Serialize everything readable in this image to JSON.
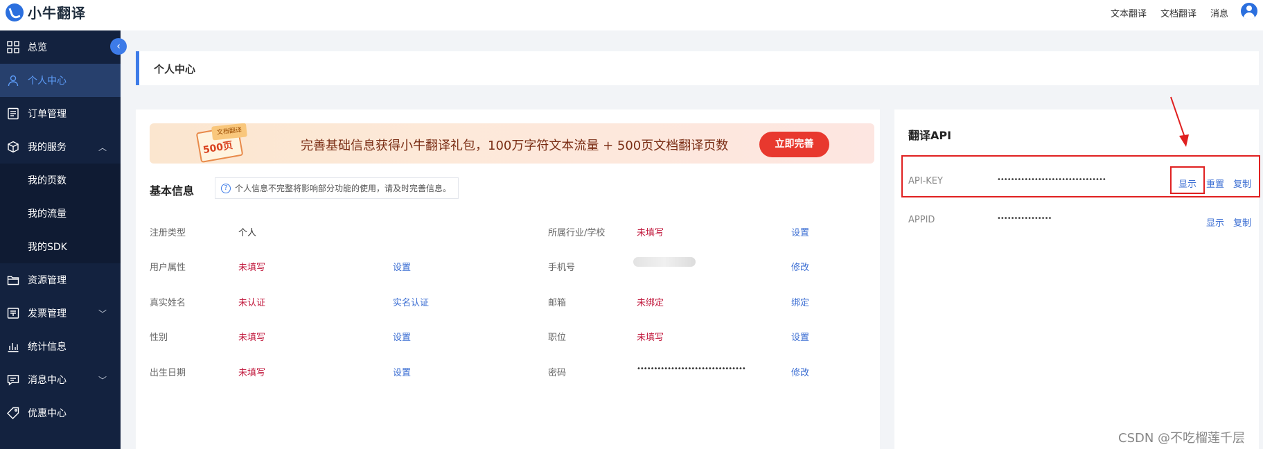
{
  "header": {
    "logo_text": "小牛翻译",
    "nav": [
      "文本翻译",
      "文档翻译",
      "消息"
    ]
  },
  "sidebar": {
    "items": [
      {
        "label": "总览",
        "icon": "grid-icon"
      },
      {
        "label": "个人中心",
        "icon": "user-icon",
        "active": true
      },
      {
        "label": "订单管理",
        "icon": "order-icon"
      },
      {
        "label": "我的服务",
        "icon": "service-icon",
        "expanded": true
      },
      {
        "label": "我的页数",
        "sub": true
      },
      {
        "label": "我的流量",
        "sub": true
      },
      {
        "label": "我的SDK",
        "sub": true
      },
      {
        "label": "资源管理",
        "icon": "folder-icon"
      },
      {
        "label": "发票管理",
        "icon": "invoice-icon"
      },
      {
        "label": "统计信息",
        "icon": "chart-icon"
      },
      {
        "label": "消息中心",
        "icon": "message-icon"
      },
      {
        "label": "优惠中心",
        "icon": "tag-icon"
      }
    ]
  },
  "page": {
    "title": "个人中心"
  },
  "banner": {
    "ticket_label": "500页",
    "ticket_top": "文档翻译",
    "text": "完善基础信息获得小牛翻译礼包，100万字符文本流量 + 500页文档翻译页数",
    "button": "立即完善"
  },
  "basic_info": {
    "title": "基本信息",
    "hint": "个人信息不完整将影响部分功能的使用，请及时完善信息。",
    "left_fields": [
      {
        "label": "注册类型",
        "value": "个人",
        "warn": false,
        "action": ""
      },
      {
        "label": "用户属性",
        "value": "未填写",
        "warn": true,
        "action": "设置"
      },
      {
        "label": "真实姓名",
        "value": "未认证",
        "warn": true,
        "action": "实名认证"
      },
      {
        "label": "性别",
        "value": "未填写",
        "warn": true,
        "action": "设置"
      },
      {
        "label": "出生日期",
        "value": "未填写",
        "warn": true,
        "action": "设置"
      }
    ],
    "right_fields": [
      {
        "label": "所属行业/学校",
        "value": "未填写",
        "warn": true,
        "action": "设置"
      },
      {
        "label": "手机号",
        "value": "",
        "warn": false,
        "action": "修改",
        "blurred": true
      },
      {
        "label": "邮箱",
        "value": "未绑定",
        "warn": true,
        "action": "绑定"
      },
      {
        "label": "职位",
        "value": "未填写",
        "warn": true,
        "action": "设置"
      },
      {
        "label": "密码",
        "value": "••••••••••••••••••••••••••••••••",
        "warn": false,
        "action": "修改"
      }
    ]
  },
  "api": {
    "title": "翻译API",
    "rows": [
      {
        "label": "API-KEY",
        "value": "••••••••••••••••••••••••••••••••",
        "actions": [
          "显示",
          "重置",
          "复制"
        ]
      },
      {
        "label": "APPID",
        "value": "••••••••••••••••",
        "actions": [
          "显示",
          "复制"
        ]
      }
    ]
  },
  "watermark": "CSDN @不吃榴莲千层",
  "colors": {
    "sidebar_bg": "#13223f",
    "accent": "#3d7be8",
    "warn": "#c1183c",
    "link": "#3d6fd3",
    "highlight": "#e02020"
  }
}
